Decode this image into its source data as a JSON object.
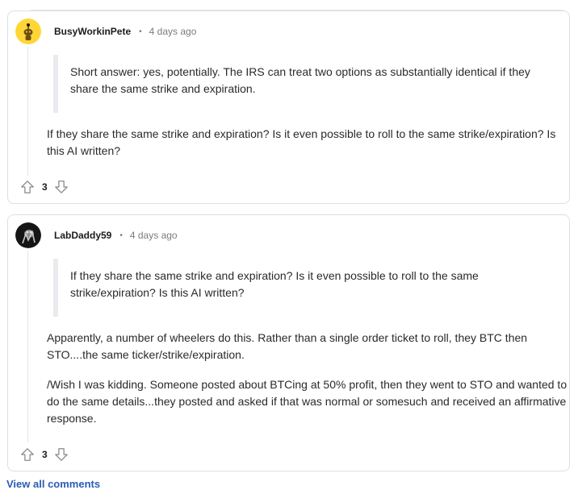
{
  "comments": [
    {
      "author": "BusyWorkinPete",
      "separator": "•",
      "time": "4 days ago",
      "avatar_icon": "reddit-snoo-avatar-yellow",
      "quote": "Short answer: yes, potentially. The IRS can treat two options as substantially identical if they share the same strike and expiration.",
      "paragraphs": [
        "If they share the same strike and expiration? Is it even possible to roll to the same strike/expiration? Is this AI written?"
      ],
      "votes": "3"
    },
    {
      "author": "LabDaddy59",
      "separator": "•",
      "time": "4 days ago",
      "avatar_icon": "dark-photo-avatar",
      "quote": "If they share the same strike and expiration? Is it even possible to roll to the same strike/expiration? Is this AI written?",
      "paragraphs": [
        "Apparently, a number of wheelers do this. Rather than a single order ticket to roll, they BTC then STO....the same ticker/strike/expiration.",
        "/Wish I was kidding. Someone posted about BTCing at 50% profit, then they went to STO and wanted to do the same details...they posted and asked if that was normal or somesuch and received an affirmative response."
      ],
      "votes": "3"
    }
  ],
  "footer": {
    "view_all": "View all comments"
  },
  "colors": {
    "upvote_icon": "#878a8c",
    "avatar1_bg": "#ffd635",
    "link": "#2a5db0"
  }
}
